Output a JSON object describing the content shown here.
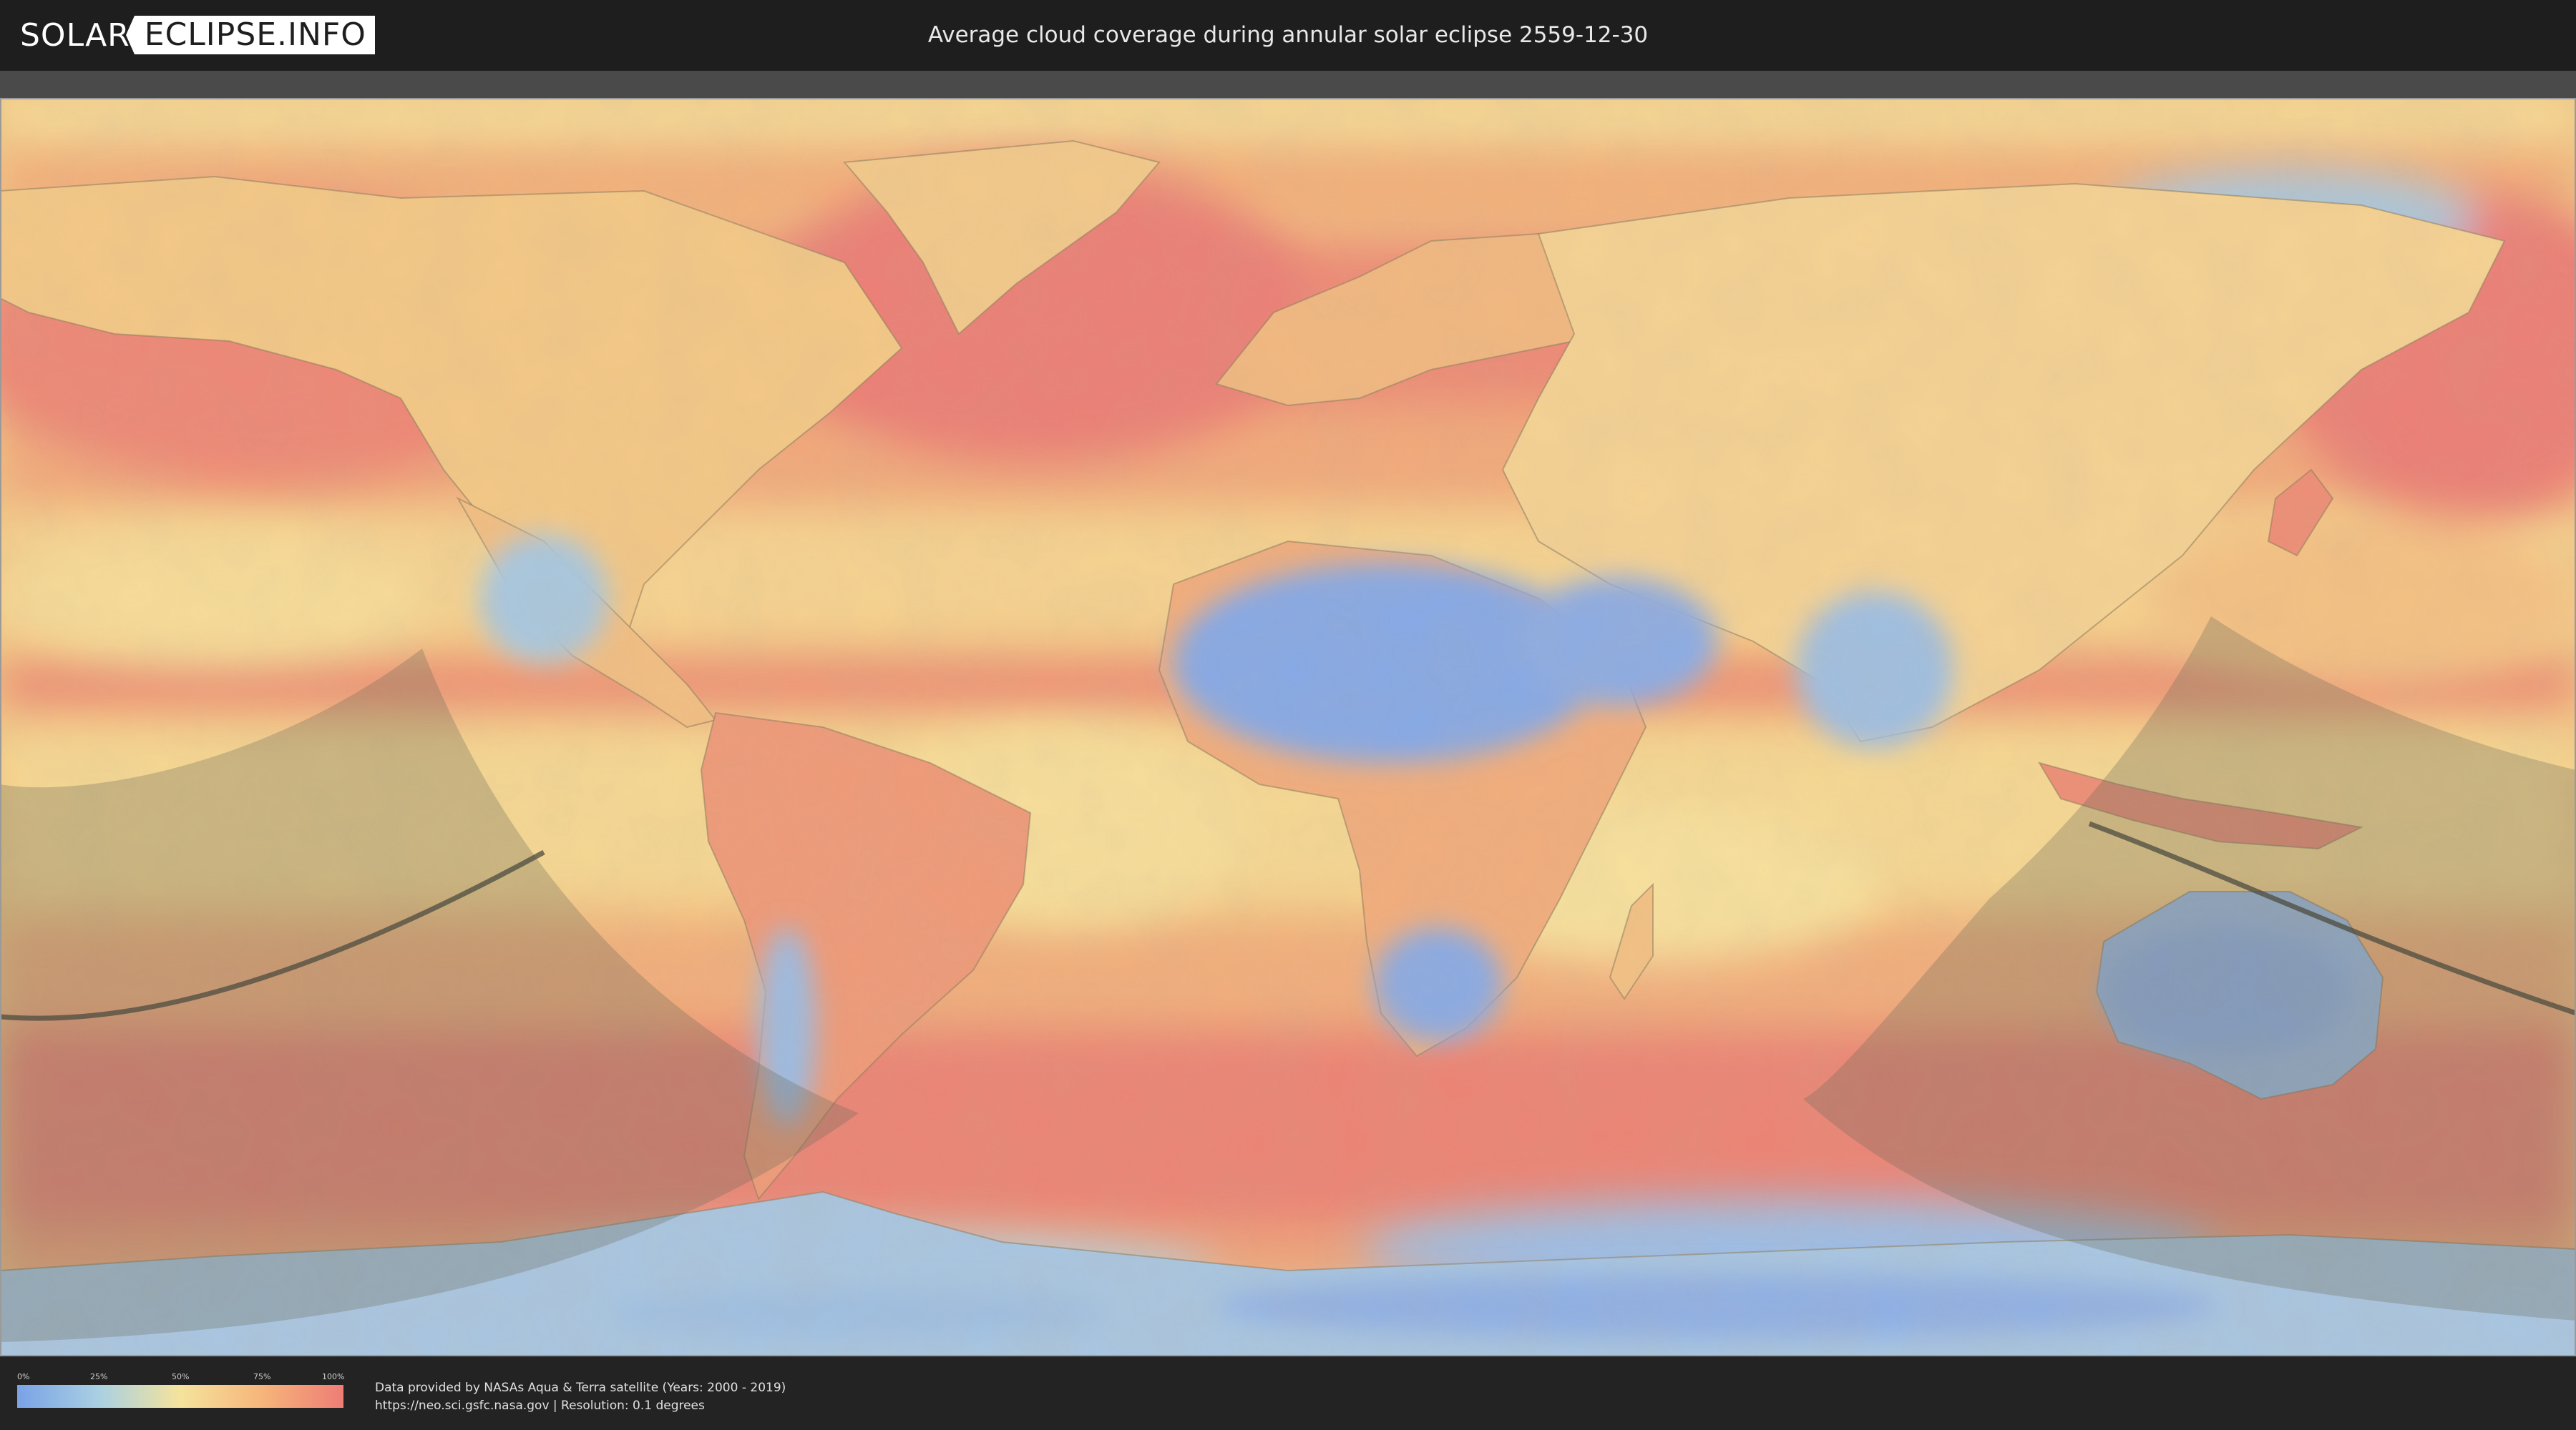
{
  "header": {
    "logo_left": "SOLAR",
    "logo_right": "ECLIPSE.INFO",
    "title": "Average cloud coverage during annular solar eclipse 2559-12-30"
  },
  "legend": {
    "ticks": [
      "0%",
      "25%",
      "50%",
      "75%",
      "100%"
    ],
    "colors": [
      "#7aa2e6",
      "#a9d0e2",
      "#f5e39c",
      "#f6b57b",
      "#ee7d76"
    ]
  },
  "footer": {
    "credit_line1": "Data provided by NASAs Aqua & Terra satellite (Years: 2000 - 2019)",
    "credit_line2": "https://neo.sci.gsfc.nasa.gov | Resolution: 0.1 degrees"
  },
  "map": {
    "projection": "equirectangular",
    "layer": "average cloud coverage",
    "overlay": "annular eclipse visibility zone with central path",
    "colors": {
      "clear": "#7aa2e6",
      "low": "#a9d0e2",
      "mid": "#f5e39c",
      "high": "#f6b57b",
      "overcast": "#ee7d76",
      "eclipse_shade": "#6b6b5a",
      "central_line": "#4c4c40"
    }
  }
}
